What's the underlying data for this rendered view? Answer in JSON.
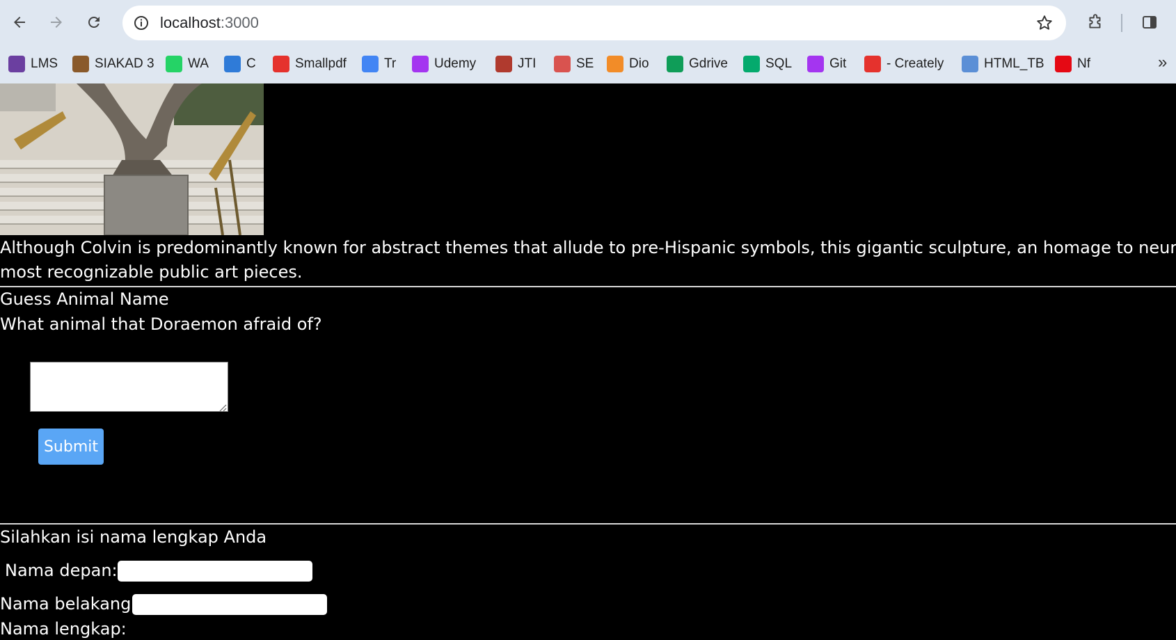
{
  "browser": {
    "url_host": "localhost",
    "url_path": ":3000",
    "bookmarks": [
      {
        "label": "LMS",
        "icon": "lms-icon",
        "color": "#6b3fa0"
      },
      {
        "label": "SIAKAD 3",
        "icon": "siakad-icon",
        "color": "#8a5a2b"
      },
      {
        "label": "WA",
        "icon": "whatsapp-icon",
        "color": "#25d366"
      },
      {
        "label": "C",
        "icon": "c-icon",
        "color": "#2f7bd8"
      },
      {
        "label": "Smallpdf",
        "icon": "smallpdf-icon",
        "color": "#e5322d"
      },
      {
        "label": "Tr",
        "icon": "translate-icon",
        "color": "#4285f4"
      },
      {
        "label": "Udemy",
        "icon": "udemy-icon",
        "color": "#a435f0"
      },
      {
        "label": "JTI",
        "icon": "jti-icon",
        "color": "#b03a2e"
      },
      {
        "label": "SE",
        "icon": "se-icon",
        "color": "#d9534f"
      },
      {
        "label": "Dio",
        "icon": "dio-icon",
        "color": "#f28c28"
      },
      {
        "label": "Gdrive",
        "icon": "gdrive-icon",
        "color": "#0f9d58"
      },
      {
        "label": "SQL",
        "icon": "w3schools-icon",
        "color": "#04aa6d"
      },
      {
        "label": "Git",
        "icon": "git-icon",
        "color": "#a435f0"
      },
      {
        "label": "- Creately",
        "icon": "creately-icon",
        "color": "#e5322d"
      },
      {
        "label": "HTML_TB",
        "icon": "html-tb-icon",
        "color": "#5b8fd6"
      },
      {
        "label": "Nf",
        "icon": "netflix-icon",
        "color": "#e50914"
      }
    ]
  },
  "page": {
    "caption_line1": "Although Colvin is predominantly known for abstract themes that allude to pre-Hispanic symbols, this gigantic sculpture, an homage to neurosurgery, is one of her",
    "caption_line2": "most recognizable public art pieces.",
    "quiz_title": "Guess Animal Name",
    "quiz_question": "What animal that Doraemon afraid of?",
    "answer_value": "",
    "submit_label": "Submit",
    "name_prompt": "Silahkan isi nama lengkap Anda",
    "first_name_label": "Nama depan:",
    "last_name_label": "Nama belakang:",
    "full_name_label": "Nama lengkap:",
    "first_name_value": "",
    "last_name_value": ""
  }
}
